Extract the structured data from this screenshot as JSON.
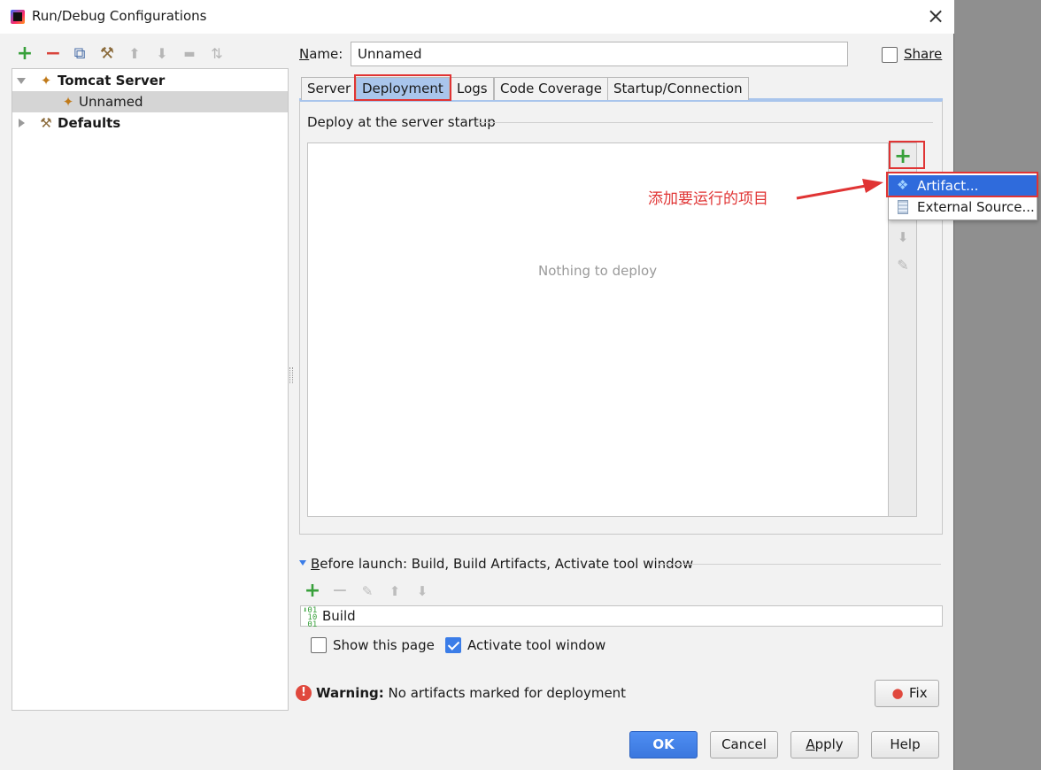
{
  "window": {
    "title": "Run/Debug Configurations",
    "close_glyph": "×"
  },
  "left_toolbar": {
    "add": "+",
    "remove": "−",
    "copy": "⧉",
    "edit_defaults": "⚒",
    "move_up": "⬆",
    "move_down": "⬇",
    "folder": "▬",
    "sort": "⇅"
  },
  "tree": {
    "items": [
      {
        "label": "Tomcat Server",
        "bold": true,
        "expanded": true
      },
      {
        "label": "Unnamed",
        "selected": true
      },
      {
        "label": "Defaults",
        "bold": true,
        "expanded": false
      }
    ]
  },
  "form": {
    "name_label_u": "N",
    "name_label_rest": "ame:",
    "name_value": "Unnamed",
    "share_label": "Share"
  },
  "tabs": [
    {
      "label": "Server"
    },
    {
      "label": "Deployment",
      "active": true
    },
    {
      "label": "Logs"
    },
    {
      "label": "Code Coverage"
    },
    {
      "label": "Startup/Connection"
    }
  ],
  "deployment": {
    "section_title": "Deploy at the server startup",
    "empty_text": "Nothing to deploy",
    "add_glyph": "+",
    "down_glyph": "⬇",
    "edit_glyph": "✎",
    "menu": [
      {
        "label": "Artifact...",
        "highlighted": true,
        "icon": "artifact-icon"
      },
      {
        "label": "External Source...",
        "icon": "external-source-icon"
      }
    ],
    "annotation": "添加要运行的项目"
  },
  "before_launch": {
    "title_u": "B",
    "title_rest": "efore launch: Build, Build Artifacts, Activate tool window",
    "add": "+",
    "remove": "−",
    "edit": "✎",
    "up": "⬆",
    "down": "⬇",
    "tasks": [
      {
        "label": "Build"
      }
    ],
    "show_page_label": "Show this page",
    "show_page_checked": false,
    "activate_label": "Activate tool window",
    "activate_checked": true
  },
  "warning": {
    "icon_glyph": "!",
    "bold": "Warning:",
    "text": "No artifacts marked for deployment",
    "fix_label": "Fix"
  },
  "buttons": {
    "ok": "OK",
    "cancel": "Cancel",
    "apply_u": "A",
    "apply_rest": "pply",
    "help": "Help"
  },
  "colors": {
    "accent_blue": "#2f6bdc",
    "active_tab": "#a9c5ec",
    "annotation_red": "#e03434",
    "add_green": "#38a03b"
  }
}
